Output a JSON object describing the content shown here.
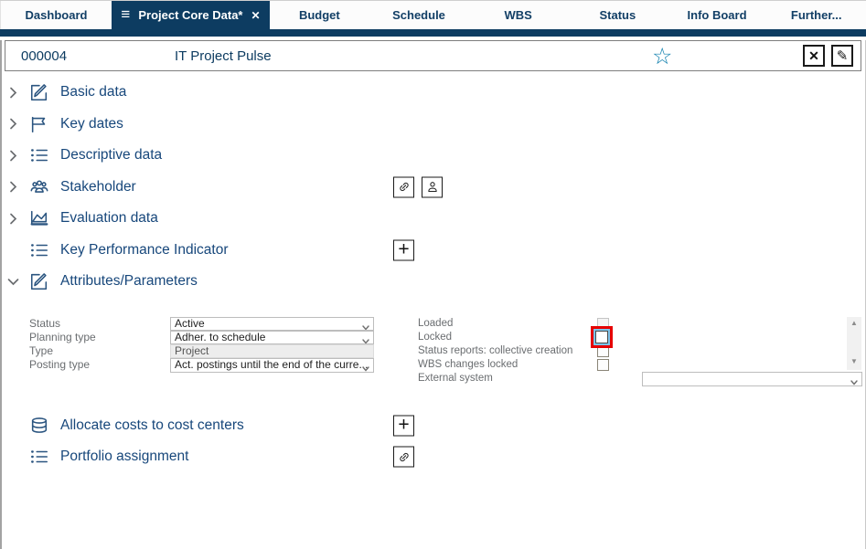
{
  "colors": {
    "navy": "#0d3c61",
    "title_navy": "#17477b",
    "star_teal": "#0f7fae",
    "label_gray": "#6a6d70",
    "highlight_red": "#e60000"
  },
  "tabs": {
    "items": [
      {
        "label": "Dashboard",
        "active": false
      },
      {
        "label": "Project Core Data*",
        "active": true
      },
      {
        "label": "Budget",
        "active": false
      },
      {
        "label": "Schedule",
        "active": false
      },
      {
        "label": "WBS",
        "active": false
      },
      {
        "label": "Status",
        "active": false
      },
      {
        "label": "Info Board",
        "active": false
      },
      {
        "label": "Further...",
        "active": false
      }
    ]
  },
  "header": {
    "project_id": "000004",
    "project_name": "IT Project Pulse"
  },
  "sections": [
    {
      "label": "Basic data",
      "icon": "edit-icon",
      "expander": "collapsed"
    },
    {
      "label": "Key dates",
      "icon": "flag-icon",
      "expander": "collapsed"
    },
    {
      "label": "Descriptive data",
      "icon": "list-icon",
      "expander": "collapsed"
    },
    {
      "label": "Stakeholder",
      "icon": "people-icon",
      "expander": "collapsed",
      "actions": [
        "link",
        "person"
      ]
    },
    {
      "label": "Evaluation data",
      "icon": "area-chart-icon",
      "expander": "collapsed"
    },
    {
      "label": "Key Performance Indicator",
      "icon": "list-icon",
      "expander": "none",
      "actions": [
        "add"
      ]
    },
    {
      "label": "Attributes/Parameters",
      "icon": "edit-icon",
      "expander": "expanded"
    }
  ],
  "form": {
    "left": [
      {
        "label": "Status",
        "value": "Active",
        "type": "select"
      },
      {
        "label": "Planning type",
        "value": "Adher. to schedule",
        "type": "select"
      },
      {
        "label": "Type",
        "value": "Project",
        "type": "readonly"
      },
      {
        "label": "Posting type",
        "value": "Act. postings until the end of the curre...",
        "type": "select"
      }
    ],
    "right": [
      {
        "label": "Loaded",
        "type": "checkbox",
        "checked": false,
        "disabled": true
      },
      {
        "label": "Locked",
        "type": "checkbox",
        "checked": false,
        "highlighted": true
      },
      {
        "label": "Status reports: collective creation",
        "type": "checkbox",
        "checked": false
      },
      {
        "label": "WBS changes locked",
        "type": "checkbox",
        "checked": false
      },
      {
        "label": "External system",
        "type": "select",
        "value": ""
      }
    ]
  },
  "bottom_sections": [
    {
      "label": "Allocate costs to cost centers",
      "icon": "database-icon",
      "actions": [
        "add"
      ]
    },
    {
      "label": "Portfolio assignment",
      "icon": "list-icon",
      "actions": [
        "link"
      ]
    }
  ],
  "icons": {
    "hamburger": "≡",
    "tab_close": "✕",
    "star": "☆",
    "header_close": "✕",
    "pencil": "✎",
    "plus": "+",
    "scroll_up": "▲",
    "scroll_down": "▼"
  }
}
